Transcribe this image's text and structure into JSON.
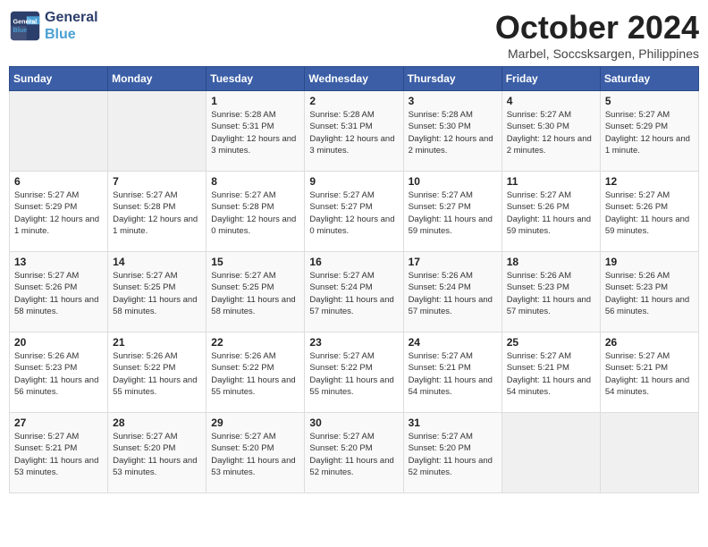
{
  "logo": {
    "line1": "General",
    "line2": "Blue"
  },
  "title": "October 2024",
  "subtitle": "Marbel, Soccsksargen, Philippines",
  "weekdays": [
    "Sunday",
    "Monday",
    "Tuesday",
    "Wednesday",
    "Thursday",
    "Friday",
    "Saturday"
  ],
  "weeks": [
    [
      {
        "day": "",
        "info": ""
      },
      {
        "day": "",
        "info": ""
      },
      {
        "day": "1",
        "info": "Sunrise: 5:28 AM\nSunset: 5:31 PM\nDaylight: 12 hours and 3 minutes."
      },
      {
        "day": "2",
        "info": "Sunrise: 5:28 AM\nSunset: 5:31 PM\nDaylight: 12 hours and 3 minutes."
      },
      {
        "day": "3",
        "info": "Sunrise: 5:28 AM\nSunset: 5:30 PM\nDaylight: 12 hours and 2 minutes."
      },
      {
        "day": "4",
        "info": "Sunrise: 5:27 AM\nSunset: 5:30 PM\nDaylight: 12 hours and 2 minutes."
      },
      {
        "day": "5",
        "info": "Sunrise: 5:27 AM\nSunset: 5:29 PM\nDaylight: 12 hours and 1 minute."
      }
    ],
    [
      {
        "day": "6",
        "info": "Sunrise: 5:27 AM\nSunset: 5:29 PM\nDaylight: 12 hours and 1 minute."
      },
      {
        "day": "7",
        "info": "Sunrise: 5:27 AM\nSunset: 5:28 PM\nDaylight: 12 hours and 1 minute."
      },
      {
        "day": "8",
        "info": "Sunrise: 5:27 AM\nSunset: 5:28 PM\nDaylight: 12 hours and 0 minutes."
      },
      {
        "day": "9",
        "info": "Sunrise: 5:27 AM\nSunset: 5:27 PM\nDaylight: 12 hours and 0 minutes."
      },
      {
        "day": "10",
        "info": "Sunrise: 5:27 AM\nSunset: 5:27 PM\nDaylight: 11 hours and 59 minutes."
      },
      {
        "day": "11",
        "info": "Sunrise: 5:27 AM\nSunset: 5:26 PM\nDaylight: 11 hours and 59 minutes."
      },
      {
        "day": "12",
        "info": "Sunrise: 5:27 AM\nSunset: 5:26 PM\nDaylight: 11 hours and 59 minutes."
      }
    ],
    [
      {
        "day": "13",
        "info": "Sunrise: 5:27 AM\nSunset: 5:26 PM\nDaylight: 11 hours and 58 minutes."
      },
      {
        "day": "14",
        "info": "Sunrise: 5:27 AM\nSunset: 5:25 PM\nDaylight: 11 hours and 58 minutes."
      },
      {
        "day": "15",
        "info": "Sunrise: 5:27 AM\nSunset: 5:25 PM\nDaylight: 11 hours and 58 minutes."
      },
      {
        "day": "16",
        "info": "Sunrise: 5:27 AM\nSunset: 5:24 PM\nDaylight: 11 hours and 57 minutes."
      },
      {
        "day": "17",
        "info": "Sunrise: 5:26 AM\nSunset: 5:24 PM\nDaylight: 11 hours and 57 minutes."
      },
      {
        "day": "18",
        "info": "Sunrise: 5:26 AM\nSunset: 5:23 PM\nDaylight: 11 hours and 57 minutes."
      },
      {
        "day": "19",
        "info": "Sunrise: 5:26 AM\nSunset: 5:23 PM\nDaylight: 11 hours and 56 minutes."
      }
    ],
    [
      {
        "day": "20",
        "info": "Sunrise: 5:26 AM\nSunset: 5:23 PM\nDaylight: 11 hours and 56 minutes."
      },
      {
        "day": "21",
        "info": "Sunrise: 5:26 AM\nSunset: 5:22 PM\nDaylight: 11 hours and 55 minutes."
      },
      {
        "day": "22",
        "info": "Sunrise: 5:26 AM\nSunset: 5:22 PM\nDaylight: 11 hours and 55 minutes."
      },
      {
        "day": "23",
        "info": "Sunrise: 5:27 AM\nSunset: 5:22 PM\nDaylight: 11 hours and 55 minutes."
      },
      {
        "day": "24",
        "info": "Sunrise: 5:27 AM\nSunset: 5:21 PM\nDaylight: 11 hours and 54 minutes."
      },
      {
        "day": "25",
        "info": "Sunrise: 5:27 AM\nSunset: 5:21 PM\nDaylight: 11 hours and 54 minutes."
      },
      {
        "day": "26",
        "info": "Sunrise: 5:27 AM\nSunset: 5:21 PM\nDaylight: 11 hours and 54 minutes."
      }
    ],
    [
      {
        "day": "27",
        "info": "Sunrise: 5:27 AM\nSunset: 5:21 PM\nDaylight: 11 hours and 53 minutes."
      },
      {
        "day": "28",
        "info": "Sunrise: 5:27 AM\nSunset: 5:20 PM\nDaylight: 11 hours and 53 minutes."
      },
      {
        "day": "29",
        "info": "Sunrise: 5:27 AM\nSunset: 5:20 PM\nDaylight: 11 hours and 53 minutes."
      },
      {
        "day": "30",
        "info": "Sunrise: 5:27 AM\nSunset: 5:20 PM\nDaylight: 11 hours and 52 minutes."
      },
      {
        "day": "31",
        "info": "Sunrise: 5:27 AM\nSunset: 5:20 PM\nDaylight: 11 hours and 52 minutes."
      },
      {
        "day": "",
        "info": ""
      },
      {
        "day": "",
        "info": ""
      }
    ]
  ]
}
